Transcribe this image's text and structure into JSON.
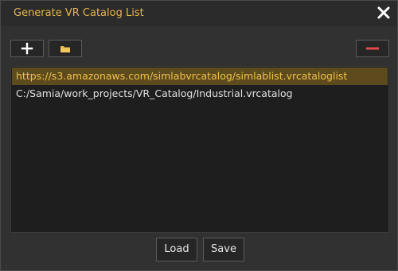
{
  "window": {
    "title": "Generate VR Catalog List"
  },
  "toolbar": {
    "add_icon": "plus-icon",
    "folder_icon": "folder-icon",
    "remove_icon": "minus-icon"
  },
  "catalog_list": {
    "items": [
      {
        "path": "https://s3.amazonaws.com/simlabvrcatalog/simlablist.vrcataloglist",
        "selected": true
      },
      {
        "path": "C:/Samia/work_projects/VR_Catalog/Industrial.vrcatalog",
        "selected": false
      }
    ]
  },
  "actions": {
    "load_label": "Load",
    "save_label": "Save"
  },
  "colors": {
    "accent": "#e8b548",
    "selection_bg": "#5d4b1e",
    "remove_red": "#e04b4b",
    "background": "#313131"
  }
}
